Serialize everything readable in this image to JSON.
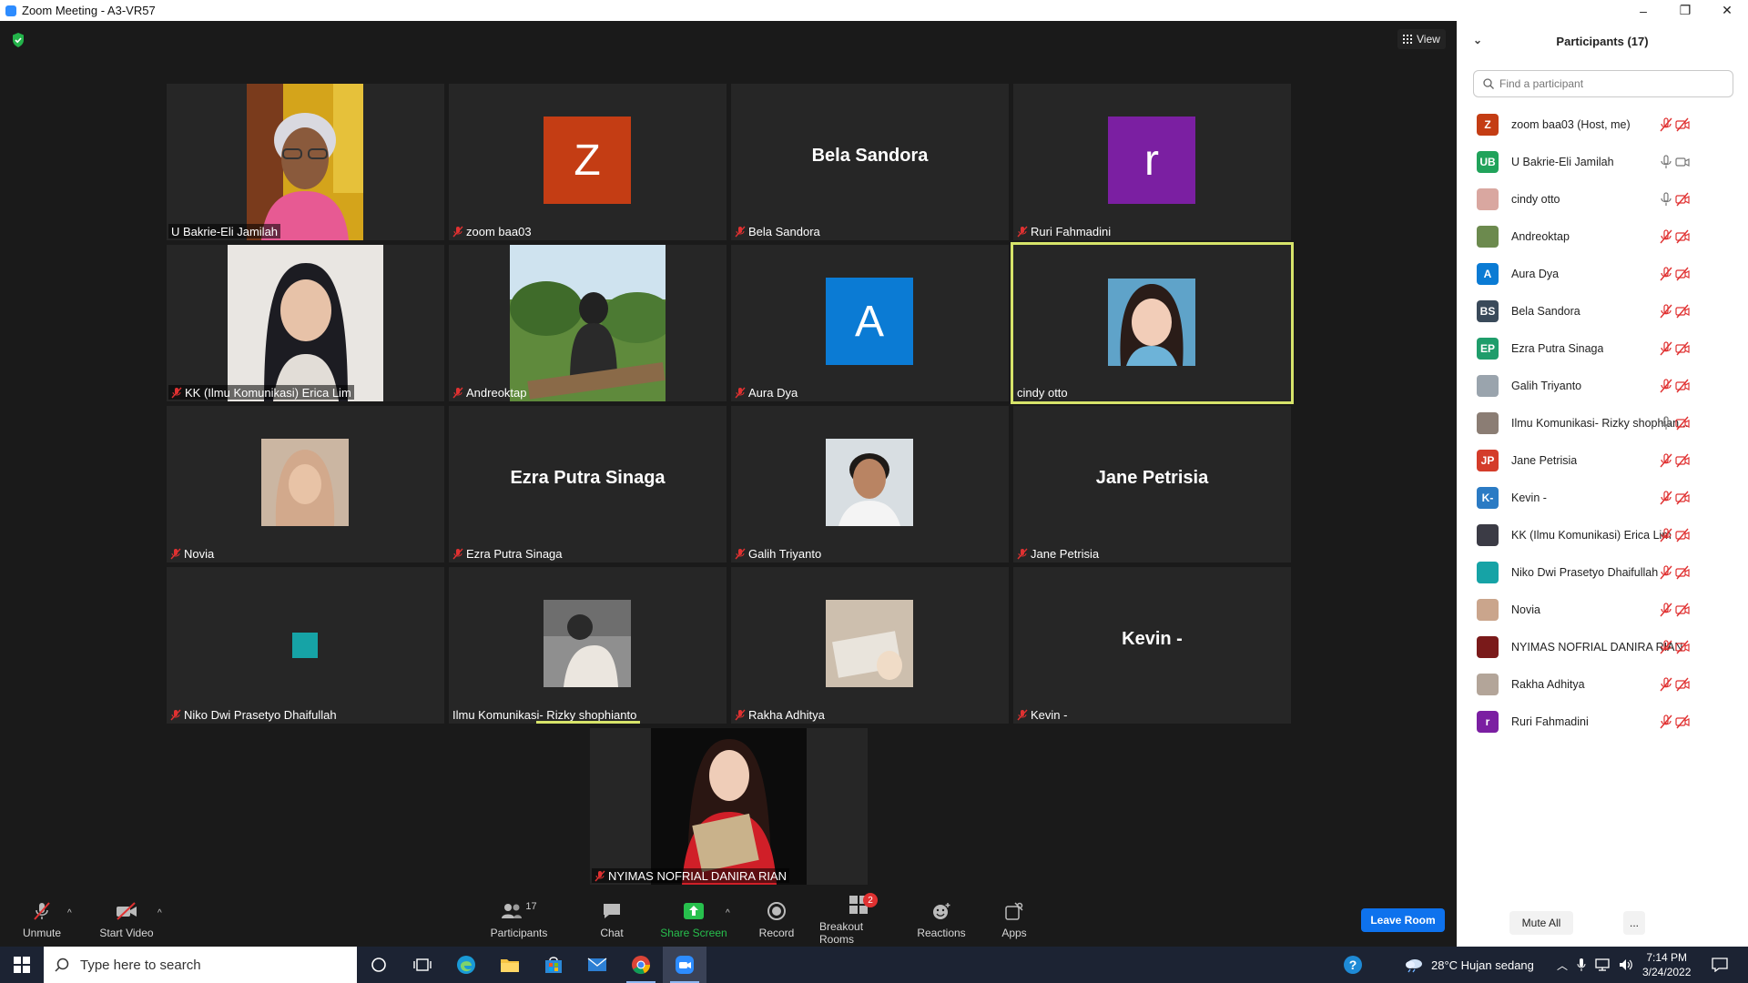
{
  "window": {
    "title": "Zoom Meeting - A3-VR57",
    "minimize": "–",
    "restore": "❐",
    "close": "✕"
  },
  "meeting": {
    "view_label": "View",
    "tiles": [
      {
        "name": "U Bakrie-Eli Jamilah",
        "kind": "photo",
        "muted": false,
        "name_bg": true
      },
      {
        "name": "zoom baa03",
        "kind": "letter",
        "letter": "Z",
        "color": "#c43d14",
        "muted": true
      },
      {
        "name": "Bela Sandora",
        "kind": "text",
        "muted": true
      },
      {
        "name": "Ruri Fahmadini",
        "kind": "letter",
        "letter": "r",
        "color": "#7b1fa2",
        "muted": true
      },
      {
        "name": "KK (Ilmu Komunikasi) Erica Lim",
        "kind": "photo",
        "muted": true,
        "name_bg": true
      },
      {
        "name": "Andreoktap",
        "kind": "photo",
        "muted": true
      },
      {
        "name": "Aura Dya",
        "kind": "letter",
        "letter": "A",
        "color": "#0b7bd4",
        "muted": true
      },
      {
        "name": "cindy otto",
        "kind": "small-photo",
        "muted": false,
        "active": true
      },
      {
        "name": "Novia",
        "kind": "small-photo",
        "muted": true
      },
      {
        "name": "Ezra Putra Sinaga",
        "kind": "text",
        "muted": true
      },
      {
        "name": "Galih Triyanto",
        "kind": "small-photo",
        "muted": true
      },
      {
        "name": "Jane Petrisia",
        "kind": "text",
        "muted": true
      },
      {
        "name": "Niko Dwi Prasetyo Dhaifullah",
        "kind": "teal",
        "muted": true
      },
      {
        "name": "Ilmu Komunikasi- Rizky shophianto",
        "kind": "small-photo",
        "muted": false,
        "speaking": true
      },
      {
        "name": "Rakha Adhitya",
        "kind": "small-photo",
        "muted": true
      },
      {
        "name": "Kevin -",
        "kind": "text",
        "muted": true
      },
      {
        "name": "NYIMAS NOFRIAL DANIRA RIAN",
        "kind": "photo",
        "muted": true,
        "name_bg": true
      }
    ]
  },
  "toolbar": {
    "unmute": "Unmute",
    "start_video": "Start Video",
    "participants": "Participants",
    "participants_count": "17",
    "chat": "Chat",
    "share_screen": "Share Screen",
    "record": "Record",
    "breakout_rooms": "Breakout Rooms",
    "breakout_badge": "2",
    "reactions": "Reactions",
    "apps": "Apps",
    "leave": "Leave Room"
  },
  "panel": {
    "title": "Participants (17)",
    "search_placeholder": "Find a participant",
    "mute_all": "Mute All",
    "more": "...",
    "participants": [
      {
        "name": "zoom baa03 (Host, me)",
        "initials": "Z",
        "color": "#c43d14",
        "mic": "off",
        "video": "off"
      },
      {
        "name": "U Bakrie-Eli Jamilah",
        "initials": "UB",
        "color": "#21a35b",
        "mic": "on",
        "video": "on"
      },
      {
        "name": "cindy otto",
        "initials": "",
        "color": "#d9a7a0",
        "mic": "on",
        "video": "off"
      },
      {
        "name": "Andreoktap",
        "initials": "",
        "color": "#6c8a4e",
        "mic": "off",
        "video": "off"
      },
      {
        "name": "Aura Dya",
        "initials": "A",
        "color": "#0b7bd4",
        "mic": "off",
        "video": "off"
      },
      {
        "name": "Bela Sandora",
        "initials": "BS",
        "color": "#3a4a5a",
        "mic": "off",
        "video": "off"
      },
      {
        "name": "Ezra Putra Sinaga",
        "initials": "EP",
        "color": "#1f9d6b",
        "mic": "off",
        "video": "off"
      },
      {
        "name": "Galih Triyanto",
        "initials": "",
        "color": "#9aa4ad",
        "mic": "off",
        "video": "off"
      },
      {
        "name": "Ilmu Komunikasi- Rizky shophian...",
        "initials": "",
        "color": "#8b7d74",
        "mic": "on",
        "video": "off"
      },
      {
        "name": "Jane Petrisia",
        "initials": "JP",
        "color": "#d43c2a",
        "mic": "off",
        "video": "off"
      },
      {
        "name": "Kevin -",
        "initials": "K-",
        "color": "#2b7bc4",
        "mic": "off",
        "video": "off"
      },
      {
        "name": "KK (Ilmu Komunikasi) Erica Lim",
        "initials": "",
        "color": "#3b3b45",
        "mic": "off",
        "video": "off"
      },
      {
        "name": "Niko Dwi Prasetyo Dhaifullah",
        "initials": "",
        "color": "#16a3a6",
        "mic": "off",
        "video": "off"
      },
      {
        "name": "Novia",
        "initials": "",
        "color": "#caa58c",
        "mic": "off",
        "video": "off"
      },
      {
        "name": "NYIMAS NOFRIAL DANIRA RIAN",
        "initials": "",
        "color": "#7a1a1a",
        "mic": "off",
        "video": "off"
      },
      {
        "name": "Rakha Adhitya",
        "initials": "",
        "color": "#b3a599",
        "mic": "off",
        "video": "off"
      },
      {
        "name": "Ruri Fahmadini",
        "initials": "r",
        "color": "#7b1fa2",
        "mic": "off",
        "video": "off"
      }
    ]
  },
  "taskbar": {
    "search_placeholder": "Type here to search",
    "weather": "28°C  Hujan sedang",
    "time": "7:14 PM",
    "date": "3/24/2022"
  }
}
